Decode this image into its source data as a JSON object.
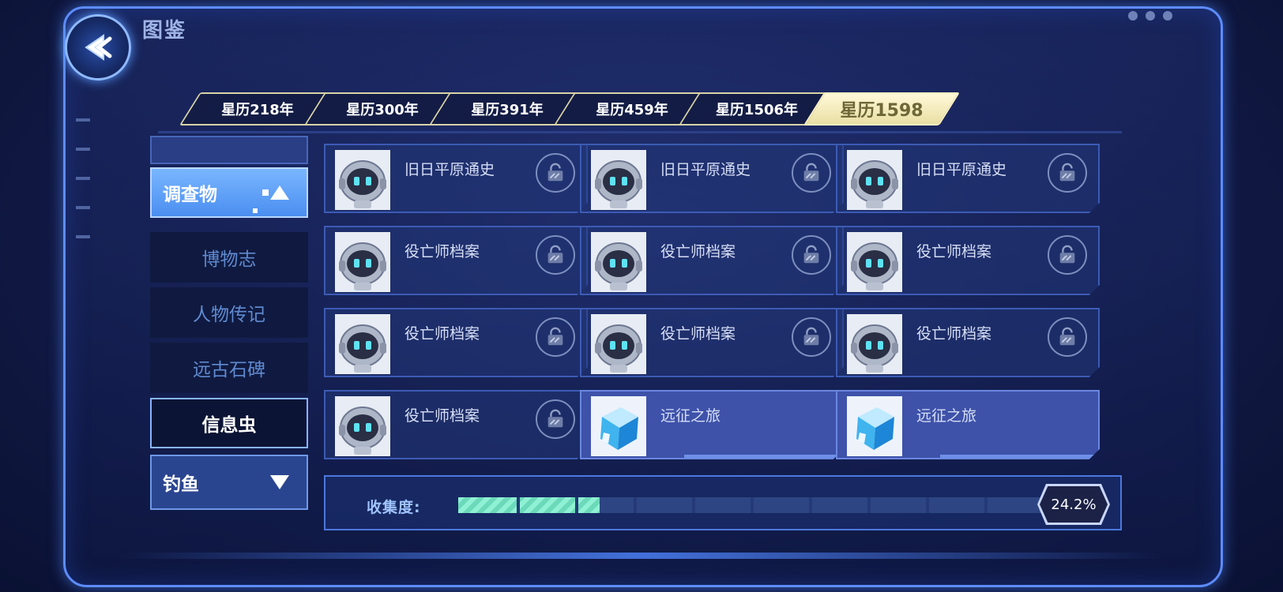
{
  "header": {
    "title": "图鉴"
  },
  "tabs": [
    {
      "label": "星历218年",
      "active": false
    },
    {
      "label": "星历300年",
      "active": false
    },
    {
      "label": "星历391年",
      "active": false
    },
    {
      "label": "星历459年",
      "active": false
    },
    {
      "label": "星历1506年",
      "active": false
    },
    {
      "label": "星历1598",
      "active": true
    }
  ],
  "sidebar": {
    "items": [
      {
        "label": "调查物",
        "state": "expanded"
      },
      {
        "label": "博物志",
        "state": "dim"
      },
      {
        "label": "人物传记",
        "state": "dim"
      },
      {
        "label": "远古石碑",
        "state": "dim"
      },
      {
        "label": "信息虫",
        "state": "current"
      },
      {
        "label": "钓鱼",
        "state": "collapsed"
      }
    ]
  },
  "cards": [
    {
      "name": "旧日平原通史",
      "icon": "robot-icon",
      "locked": true
    },
    {
      "name": "旧日平原通史",
      "icon": "robot-icon",
      "locked": true
    },
    {
      "name": "旧日平原通史",
      "icon": "robot-icon",
      "locked": true
    },
    {
      "name": "役亡师档案",
      "icon": "robot-icon",
      "locked": true
    },
    {
      "name": "役亡师档案",
      "icon": "robot-icon",
      "locked": true
    },
    {
      "name": "役亡师档案",
      "icon": "robot-icon",
      "locked": true
    },
    {
      "name": "役亡师档案",
      "icon": "robot-icon",
      "locked": true
    },
    {
      "name": "役亡师档案",
      "icon": "robot-icon",
      "locked": true
    },
    {
      "name": "役亡师档案",
      "icon": "robot-icon",
      "locked": true
    },
    {
      "name": "役亡师档案",
      "icon": "robot-icon",
      "locked": true
    },
    {
      "name": "远征之旅",
      "icon": "blue-cube-icon",
      "locked": false
    },
    {
      "name": "远征之旅",
      "icon": "blue-cube-icon",
      "locked": false
    }
  ],
  "collection": {
    "label": "收集度:",
    "percent_text": "24.2%",
    "fraction": 0.242
  },
  "colors": {
    "accent": "#5d8cff",
    "progress": "#8ff1d3",
    "active_tab": "#fff9d8"
  }
}
